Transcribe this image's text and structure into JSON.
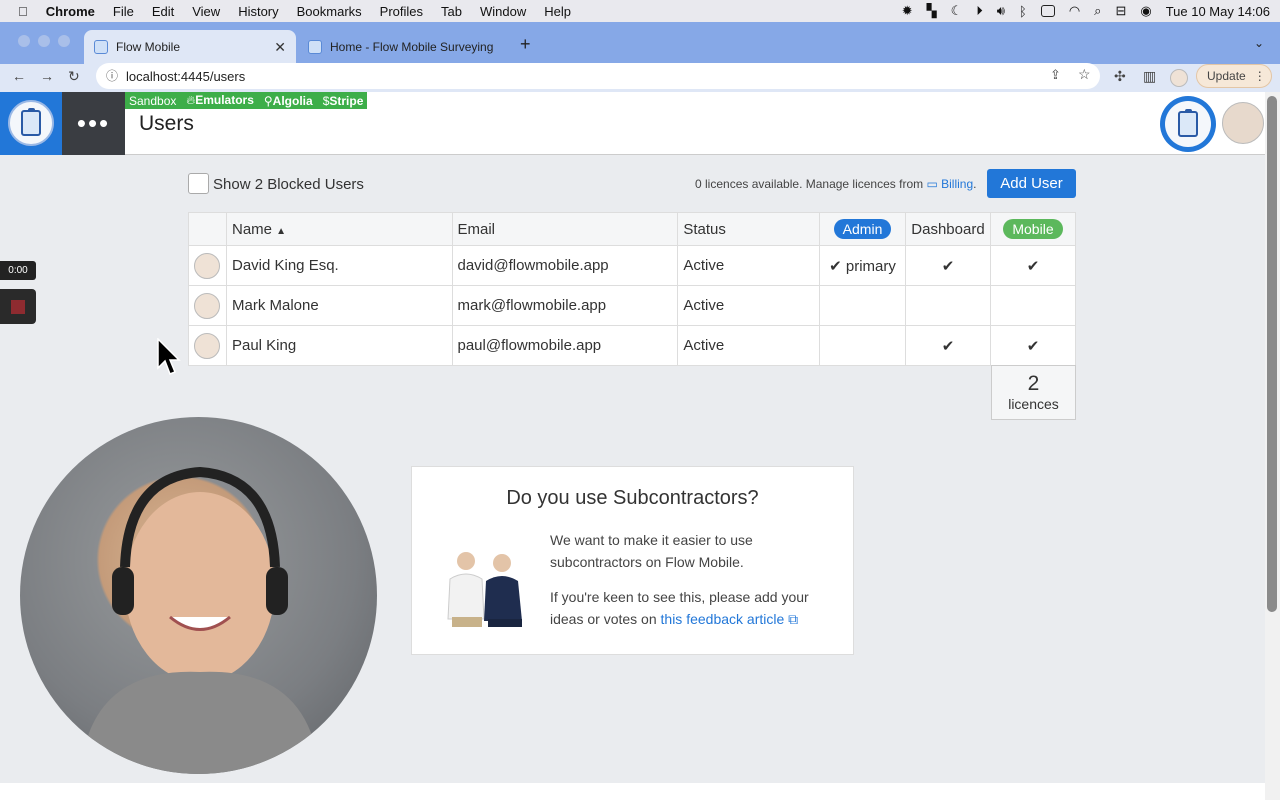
{
  "menubar": {
    "apple": "",
    "items": [
      "Chrome",
      "File",
      "Edit",
      "View",
      "History",
      "Bookmarks",
      "Profiles",
      "Tab",
      "Window",
      "Help"
    ],
    "clock": "Tue 10 May  14:06"
  },
  "browser": {
    "tabs": [
      {
        "title": "Flow Mobile",
        "active": true
      },
      {
        "title": "Home - Flow Mobile Surveying",
        "active": false
      }
    ],
    "url": "localhost:4445/users",
    "update_label": "Update"
  },
  "app": {
    "env": {
      "sandbox": "Sandbox",
      "emulators": "Emulators",
      "algolia": "Algolia",
      "stripe": "Stripe"
    },
    "page_title": "Users",
    "menu_glyph": "•••"
  },
  "toolbar": {
    "blocked_label": "Show 2 Blocked Users",
    "licence_text": "0 licences available. Manage licences from ",
    "billing_link": "Billing",
    "licence_suffix": ".",
    "add_user": "Add User"
  },
  "table": {
    "headers": {
      "name": "Name",
      "email": "Email",
      "status": "Status",
      "admin": "Admin",
      "dashboard": "Dashboard",
      "mobile": "Mobile"
    },
    "rows": [
      {
        "name": "David King Esq.",
        "email": "david@flowmobile.app",
        "status": "Active",
        "admin": "✔ primary",
        "dashboard": "✔",
        "mobile": "✔"
      },
      {
        "name": "Mark Malone",
        "email": "mark@flowmobile.app",
        "status": "Active",
        "admin": "",
        "dashboard": "",
        "mobile": ""
      },
      {
        "name": "Paul King",
        "email": "paul@flowmobile.app",
        "status": "Active",
        "admin": "",
        "dashboard": "✔",
        "mobile": "✔"
      }
    ],
    "total_count": "2",
    "total_label": "licences"
  },
  "recording": {
    "time": "0:00"
  },
  "card": {
    "title": "Do you use Subcontractors?",
    "p1": "We want to make it easier to use subcontractors on Flow Mobile.",
    "p2": "If you're keen to see this, please add your ideas or votes on ",
    "link": "this feedback article"
  }
}
